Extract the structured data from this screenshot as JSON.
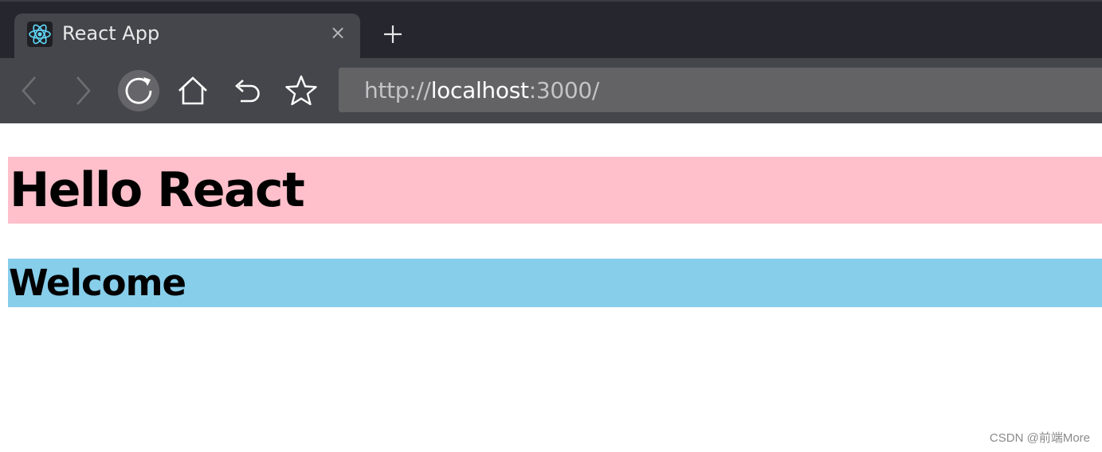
{
  "browser": {
    "tab": {
      "title": "React App",
      "close_glyph": "×",
      "favicon": "react-logo-icon"
    },
    "new_tab_icon": "plus-icon",
    "toolbar": {
      "back_icon": "chevron-left-icon",
      "forward_icon": "chevron-right-icon",
      "reload_icon": "reload-icon",
      "home_icon": "home-icon",
      "undo_icon": "undo-icon",
      "bookmark_icon": "star-icon"
    },
    "address": {
      "scheme": "http://",
      "host": "localhost",
      "rest": ":3000/"
    }
  },
  "page": {
    "heading1": "Hello React",
    "heading2": "Welcome"
  },
  "watermark": "CSDN @前端More",
  "colors": {
    "heading1_bg": "#ffc0cb",
    "heading2_bg": "#87ceeb",
    "favicon_accent": "#61dafb"
  }
}
